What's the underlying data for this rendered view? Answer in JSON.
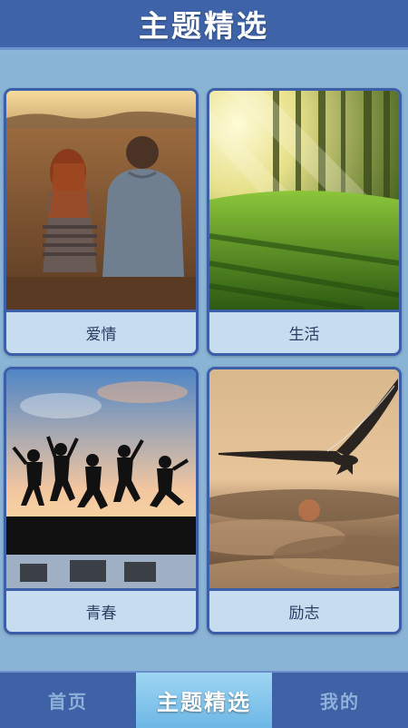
{
  "header": {
    "title": "主题精选"
  },
  "cards": [
    {
      "label": "爱情",
      "image": "couple-sunset"
    },
    {
      "label": "生活",
      "image": "forest-sunrays"
    },
    {
      "label": "青春",
      "image": "jumping-silhouettes"
    },
    {
      "label": "励志",
      "image": "eagle-over-clouds"
    }
  ],
  "tabs": [
    {
      "label": "首页",
      "active": false
    },
    {
      "label": "主题精选",
      "active": true
    },
    {
      "label": "我的",
      "active": false
    }
  ],
  "colors": {
    "header_bg": "#3e63a8",
    "page_bg": "#8ab4d5",
    "card_border": "#3d5ea8",
    "card_label_bg": "#c7dcee",
    "active_tab_bg": "#6db7e6"
  }
}
